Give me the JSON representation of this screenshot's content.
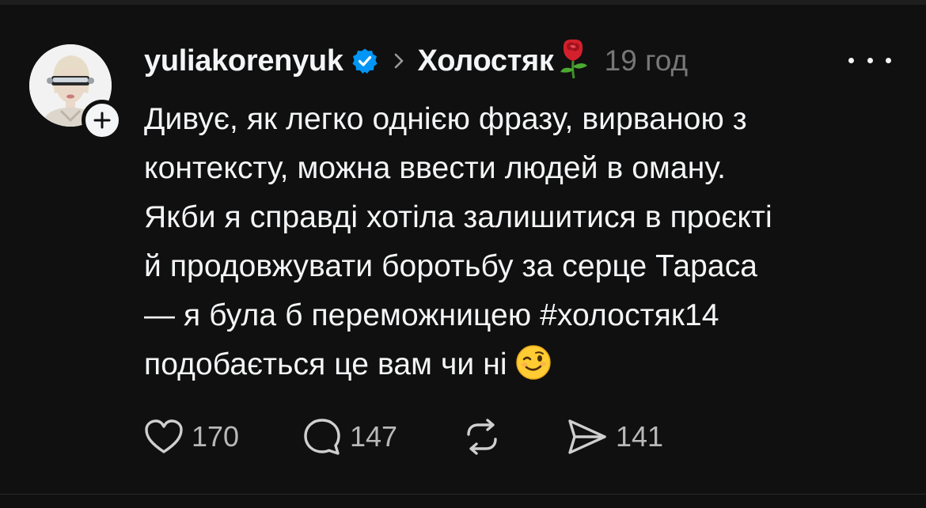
{
  "post": {
    "author": {
      "username": "yuliakorenyuk",
      "verified": true,
      "avatar_icon": "avatar-photo"
    },
    "community": "Холостяк",
    "community_emoji": "rose-emoji",
    "time_ago": "19 год",
    "text_lines": [
      "Дивує, як легко однією фразу, вирваною з",
      "контексту, можна ввести людей в оману.",
      "Якби я справді хотіла залишитися в проєкті",
      "й продовжувати боротьбу за серце Тараса",
      "— я була б переможницею #холостяк14",
      "подобається це вам чи ні"
    ],
    "trailing_emoji": "winking-face-emoji"
  },
  "actions": {
    "likes": "170",
    "comments": "147",
    "reposts": "",
    "shares": "141"
  },
  "colors": {
    "background": "#101010",
    "text_primary": "#f3f5f7",
    "text_secondary": "#777777",
    "verified_blue": "#0095f6"
  }
}
